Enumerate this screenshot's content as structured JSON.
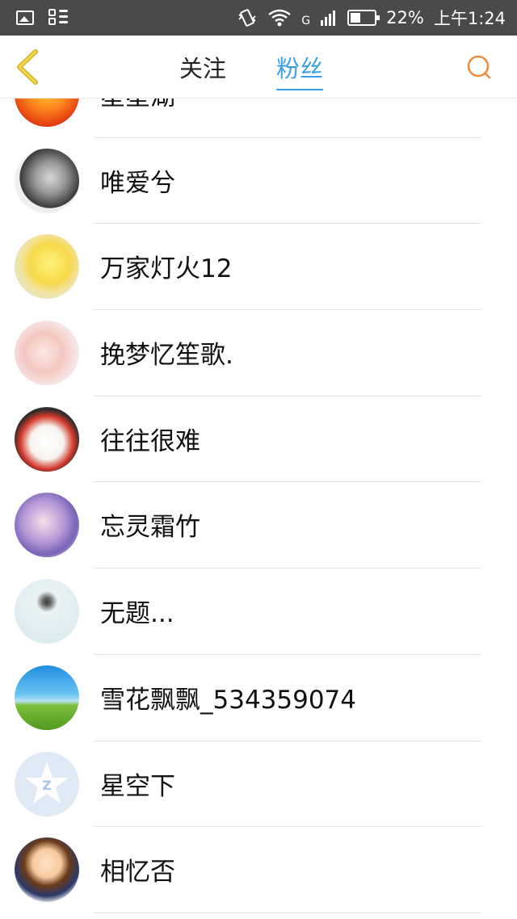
{
  "status_bar": {
    "battery": "22%",
    "time": "上午1:24",
    "network": "G"
  },
  "header": {
    "tabs": [
      {
        "label": "关注",
        "active": false
      },
      {
        "label": "粉丝",
        "active": true
      }
    ],
    "accent_color": "#3aa0e6",
    "back_icon": "chevron-left-icon",
    "search_icon": "search-icon"
  },
  "fans": [
    {
      "name": "星星湖",
      "avatar": "fire"
    },
    {
      "name": "唯爱兮",
      "avatar": "girl-bw"
    },
    {
      "name": "万家灯火12",
      "avatar": "pikachu"
    },
    {
      "name": "挽梦忆笙歌.",
      "avatar": "anime-girl"
    },
    {
      "name": "往往很难",
      "avatar": "dog"
    },
    {
      "name": "忘灵霜竹",
      "avatar": "chibi"
    },
    {
      "name": "无题...",
      "avatar": "girl-white"
    },
    {
      "name": "雪花飘飘_534359074",
      "avatar": "sky"
    },
    {
      "name": "星空下",
      "avatar": "qzone-default"
    },
    {
      "name": "相忆否",
      "avatar": "cartoon-boy"
    }
  ]
}
